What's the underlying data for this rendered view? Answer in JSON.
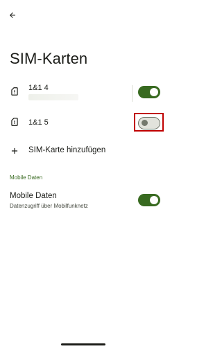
{
  "header": {
    "back_icon": "arrow-back-icon",
    "title": "SIM-Karten"
  },
  "sims": [
    {
      "name": "1&1 4",
      "icon": "sim-card-icon",
      "enabled": true
    },
    {
      "name": "1&1 5",
      "icon": "sim-card-icon",
      "enabled": false
    }
  ],
  "add_sim": {
    "icon": "plus-icon",
    "label": "SIM-Karte hinzufügen"
  },
  "mobile_data": {
    "section_header": "Mobile Daten",
    "title": "Mobile Daten",
    "subtitle": "Datenzugriff über Mobilfunknetz",
    "enabled": true
  },
  "colors": {
    "accent": "#386a20",
    "switch_off_track": "#e2e3dc",
    "switch_off_outline": "#74796d",
    "highlight": "#c00000"
  }
}
